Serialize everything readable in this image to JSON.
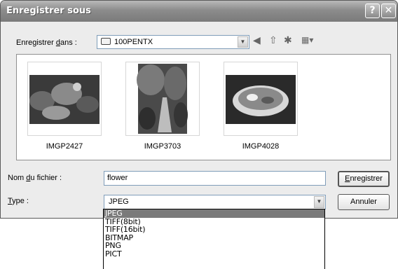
{
  "dialog": {
    "title": "Enregistrer sous",
    "help_label": "?",
    "close_label": "✕"
  },
  "save_in": {
    "label_pre": "Enregistrer ",
    "label_key": "d",
    "label_post": "ans :",
    "value": "100PENTX"
  },
  "toolbar": {
    "back_icon": "◀",
    "up_icon": "⇧",
    "new_folder_icon": "✱",
    "view_icon": "▦▾"
  },
  "files": [
    {
      "name": "IMGP2427"
    },
    {
      "name": "IMGP3703"
    },
    {
      "name": "IMGP4028"
    }
  ],
  "filename": {
    "label_pre": "Nom ",
    "label_key": "d",
    "label_post": "u fichier :",
    "value": "flower"
  },
  "filetype": {
    "label_key": "T",
    "label_post": "ype :",
    "value": "JPEG",
    "options": [
      "JPEG",
      "TIFF(8bit)",
      "TIFF(16bit)",
      "BITMAP",
      "PNG",
      "PICT"
    ]
  },
  "buttons": {
    "save_key": "E",
    "save_post": "nregistrer",
    "cancel": "Annuler"
  }
}
